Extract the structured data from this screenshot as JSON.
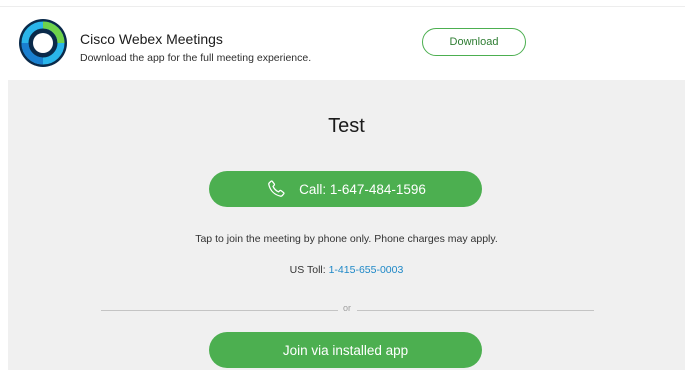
{
  "banner": {
    "app_title": "Cisco Webex Meetings",
    "app_subtitle": "Download the app for the full meeting experience.",
    "download_label": "Download",
    "logo_icon": "webex-logo-icon"
  },
  "meeting": {
    "title": "Test",
    "call_label": "Call: 1-647-484-1596",
    "call_icon": "phone-icon",
    "phone_note": "Tap to join the meeting by phone only. Phone charges may apply.",
    "toll_label": "US Toll:",
    "toll_number": "1-415-655-0003",
    "divider_text": "or",
    "join_label": "Join via installed app"
  },
  "colors": {
    "accent_green": "#4caf50",
    "link_blue": "#1e88c7",
    "panel_bg": "#f0f0f0"
  }
}
